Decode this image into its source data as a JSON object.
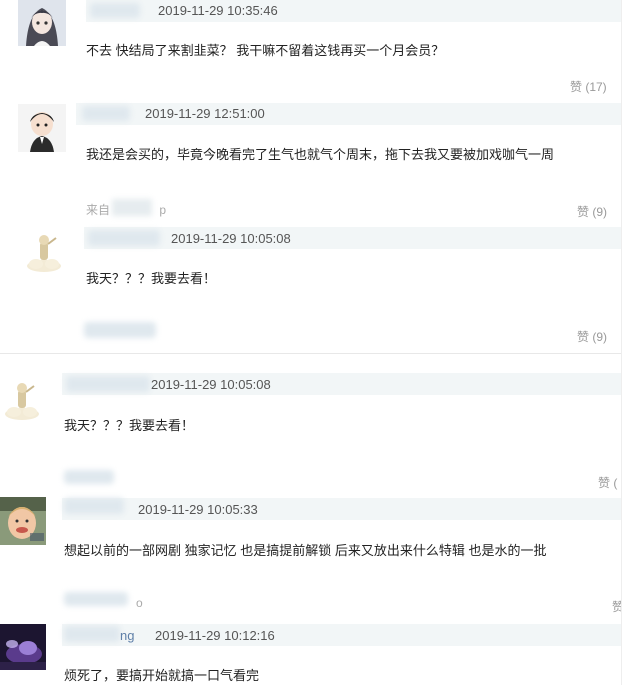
{
  "comments": [
    {
      "time": "2019-11-29 10:35:46",
      "text": "不去 快结局了来割韭菜？ 我干嘛不留着这钱再买一个月会员？",
      "like": "赞 (17)",
      "avatar_icon": "girl-avatar-icon"
    },
    {
      "time": "2019-11-29 12:51:00",
      "text": "我还是会买的，毕竟今晚看完了生气也就气个周末，拖下去我又要被加戏咖气一周",
      "source_start": "来自",
      "source_end": "p",
      "like": "赞 (9)",
      "avatar_icon": "boy-avatar-icon"
    },
    {
      "time": "2019-11-29 10:05:08",
      "text": "我天？？？我要去看！",
      "like": "赞 (9)",
      "avatar_icon": "cloud-figure-avatar-icon"
    },
    {
      "time": "2019-11-29 10:05:08",
      "text": "我天？？？我要去看！",
      "like": "赞 (",
      "avatar_icon": "cloud-figure-avatar-icon"
    },
    {
      "time": "2019-11-29 10:05:33",
      "text": "想起以前的一部网剧 独家记忆 也是搞提前解锁 后来又放出来什么特辑 也是水的一批",
      "source_end": "o",
      "avatar_icon": "child-photo-avatar-icon"
    },
    {
      "name_tail": "ng",
      "time": "2019-11-29 10:12:16",
      "text": "烦死了，要搞开始就搞一口气看完",
      "avatar_icon": "purple-photo-avatar-icon"
    }
  ],
  "colors": {
    "namebar": "#f2f6f7",
    "like_text": "#999999",
    "divider": "#e8e8e8"
  }
}
